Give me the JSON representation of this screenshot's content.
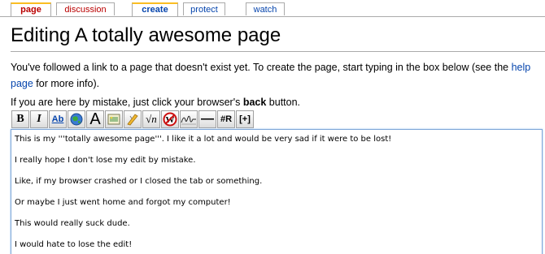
{
  "tabs": [
    {
      "label": "page"
    },
    {
      "label": "discussion"
    },
    {
      "label": "create"
    },
    {
      "label": "protect"
    },
    {
      "label": "watch"
    }
  ],
  "page_title": "Editing A totally awesome page",
  "intro": {
    "text_before_link": "You've followed a link to a page that doesn't exist yet. To create the page, start typing in the box below (see the ",
    "link_text": "help page",
    "text_after_link": " for more info)."
  },
  "mistake": {
    "text_before": "If you are here by mistake, just click your browser's ",
    "bold": "back",
    "text_after": " button."
  },
  "toolbar": {
    "bold_label": "B",
    "italic_label": "I",
    "link_label": "Ab",
    "headline_label": "A",
    "math_label": "√n",
    "hr_label": "—",
    "redirect_label": "#R",
    "ref_label": "[+]"
  },
  "editor": {
    "lines": [
      "This is my '''totally awesome page'''. I like it a lot and would be very sad if it were to be lost!",
      "I really hope I don't lose my edit by mistake.",
      "Like, if my browser crashed or I closed the tab or something.",
      "Or maybe I just went home and forgot my computer!",
      "This would really suck dude.",
      "I would hate to lose the edit!"
    ]
  },
  "colors": {
    "link": "#0645ad",
    "new_link": "#ba0000",
    "selected_tab_accent": "#fabd23",
    "editor_border": "#7ea6d8"
  }
}
